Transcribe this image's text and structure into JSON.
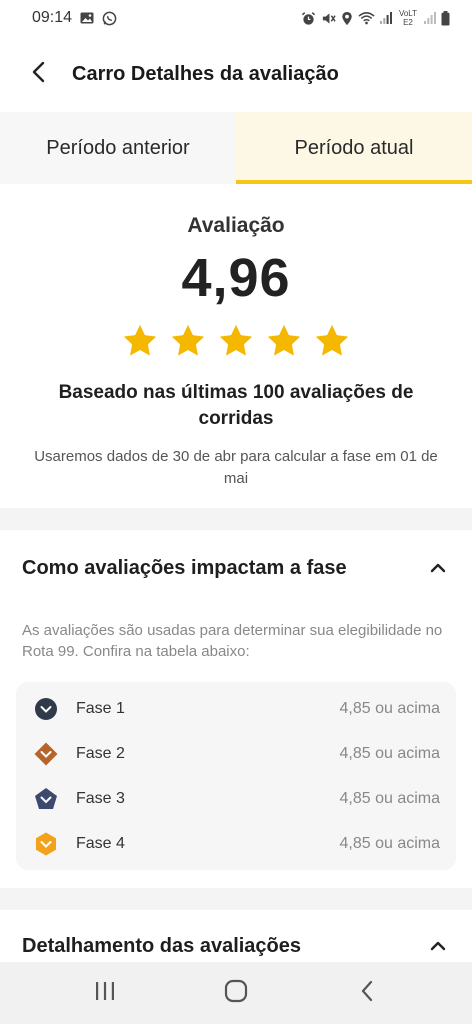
{
  "status_bar": {
    "time": "09:14",
    "icons": [
      "image-icon",
      "whatsapp-icon",
      "alarm-icon",
      "mute-icon",
      "location-icon",
      "wifi-icon",
      "signal-icon",
      "volte-icon",
      "signal-icon",
      "battery-icon"
    ],
    "network_label": "VoLTE2"
  },
  "header": {
    "title": "Carro Detalhes da avaliação",
    "back_icon": "chevron-left-icon"
  },
  "tabs": [
    {
      "label": "Período anterior",
      "selected": false
    },
    {
      "label": "Período atual",
      "selected": true
    }
  ],
  "rating": {
    "label": "Avaliação",
    "value": "4,96",
    "stars_filled": 5,
    "stars_total": 5,
    "based_on": "Baseado nas últimas 100 avaliações de corridas",
    "data_note": "Usaremos dados de 30 de abr para calcular a fase em 01 de mai"
  },
  "impact": {
    "title": "Como avaliações impactam a fase",
    "expanded": true,
    "description": "As avaliações são usadas para determinar sua elegibilidade no Rota 99. Confira na tabela abaixo:",
    "phases": [
      {
        "name": "Fase 1",
        "requirement": "4,85 ou acima",
        "badge_icon": "phase-1-badge-icon",
        "color": "#2f3a4a"
      },
      {
        "name": "Fase 2",
        "requirement": "4,85 ou acima",
        "badge_icon": "phase-2-badge-icon",
        "color": "#b5652b"
      },
      {
        "name": "Fase 3",
        "requirement": "4,85 ou acima",
        "badge_icon": "phase-3-badge-icon",
        "color": "#3d4a6e"
      },
      {
        "name": "Fase 4",
        "requirement": "4,85 ou acima",
        "badge_icon": "phase-4-badge-icon",
        "color": "#f2a31b"
      }
    ]
  },
  "breakdown": {
    "title": "Detalhamento das avaliações",
    "expanded": true
  },
  "nav_bar": {
    "buttons": [
      "recent-apps-icon",
      "home-icon",
      "back-icon"
    ]
  },
  "colors": {
    "accent": "#f5c518",
    "star": "#f5b800",
    "tab_selected_bg": "#fdf8e6"
  }
}
